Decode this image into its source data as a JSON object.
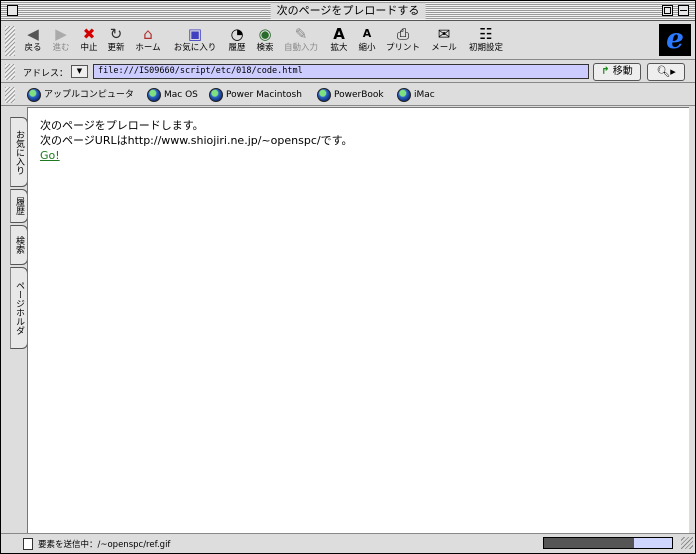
{
  "window": {
    "title": "次のページをプレロードする"
  },
  "toolbar": {
    "buttons": [
      {
        "label": "戻る",
        "icon": "back-arrow-icon",
        "enabled": true
      },
      {
        "label": "進む",
        "icon": "forward-arrow-icon",
        "enabled": false
      },
      {
        "label": "中止",
        "icon": "stop-icon",
        "enabled": true
      },
      {
        "label": "更新",
        "icon": "refresh-icon",
        "enabled": true
      },
      {
        "label": "ホーム",
        "icon": "home-icon",
        "enabled": true
      },
      {
        "label": "お気に入り",
        "icon": "favorites-icon",
        "enabled": true
      },
      {
        "label": "履歴",
        "icon": "history-icon",
        "enabled": true
      },
      {
        "label": "検索",
        "icon": "search-icon",
        "enabled": true
      },
      {
        "label": "自動入力",
        "icon": "autofill-icon",
        "enabled": false
      },
      {
        "label": "拡大",
        "icon": "text-larger-icon",
        "enabled": true
      },
      {
        "label": "縮小",
        "icon": "text-smaller-icon",
        "enabled": true
      },
      {
        "label": "プリント",
        "icon": "print-icon",
        "enabled": true
      },
      {
        "label": "メール",
        "icon": "mail-icon",
        "enabled": true
      },
      {
        "label": "初期設定",
        "icon": "preferences-icon",
        "enabled": true
      }
    ]
  },
  "address": {
    "label": "アドレス：",
    "url": "file:///IS09660/script/etc/018/code.html",
    "go_label": "移動"
  },
  "favorites": {
    "items": [
      "アップルコンピュータ",
      "Mac OS",
      "Power Macintosh",
      "PowerBook",
      "iMac"
    ]
  },
  "explorer_tabs": [
    "お気に入り",
    "履歴",
    "検索",
    "ページホルダ"
  ],
  "content": {
    "line1": "次のページをプレロードします。",
    "line2": "次のページURLはhttp://www.shiojiri.ne.jp/~openspc/です。",
    "link": "Go!"
  },
  "status": {
    "text": "要素を送信中：/~openspc/ref.gif",
    "progress_fraction": 0.7
  },
  "colors": {
    "address_field": "#ccccff",
    "link": "#1f7a1f",
    "progress": "#555555"
  }
}
